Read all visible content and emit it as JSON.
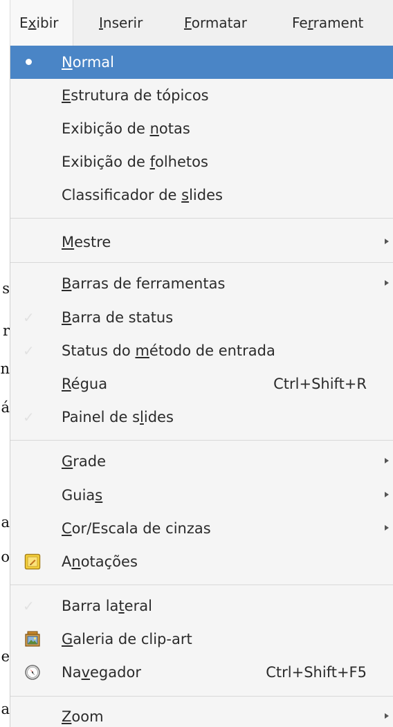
{
  "background_doc_chars": [
    "s",
    "r",
    "n",
    "á",
    "a",
    "o",
    "e",
    "a"
  ],
  "menubar": {
    "items": [
      {
        "pre": "E",
        "u": "x",
        "post": "ibir"
      },
      {
        "pre": "",
        "u": "I",
        "post": "nserir"
      },
      {
        "pre": "",
        "u": "F",
        "post": "ormatar"
      },
      {
        "pre": "Fe",
        "u": "r",
        "post": "rament"
      }
    ]
  },
  "menu": {
    "items": [
      {
        "pre": "",
        "u": "N",
        "post": "ormal",
        "state": "radio-selected",
        "highlighted": true
      },
      {
        "pre": "",
        "u": "E",
        "post": "strutura de tópicos"
      },
      {
        "pre": "Exibição de ",
        "u": "n",
        "post": "otas"
      },
      {
        "pre": "Exibição de ",
        "u": "f",
        "post": "olhetos"
      },
      {
        "pre": "Classificador de ",
        "u": "s",
        "post": "lides"
      },
      {
        "pre": "",
        "u": "M",
        "post": "estre",
        "submenu": true
      },
      {
        "pre": "",
        "u": "B",
        "post": "arras de ferramentas",
        "submenu": true
      },
      {
        "pre": "",
        "u": "B",
        "post": "arra de status",
        "check": "✓"
      },
      {
        "pre": "Status do ",
        "u": "m",
        "post": "étodo de entrada",
        "check": "✓"
      },
      {
        "pre": "",
        "u": "R",
        "post": "égua",
        "shortcut": "Ctrl+Shift+R"
      },
      {
        "pre": "Painel de s",
        "u": "l",
        "post": "ides",
        "check": "✓"
      },
      {
        "pre": "",
        "u": "G",
        "post": "rade",
        "submenu": true
      },
      {
        "pre": "Guia",
        "u": "s",
        "post": "",
        "submenu": true
      },
      {
        "pre": "",
        "u": "C",
        "post": "or/Escala de cinzas",
        "submenu": true
      },
      {
        "pre": "A",
        "u": "n",
        "post": "otações",
        "icon": "annotations-icon"
      },
      {
        "pre": "Barra la",
        "u": "t",
        "post": "eral",
        "check": "✓"
      },
      {
        "pre": "",
        "u": "G",
        "post": "aleria de clip-art",
        "icon": "gallery-icon"
      },
      {
        "pre": "Na",
        "u": "v",
        "post": "egador",
        "shortcut": "Ctrl+Shift+F5",
        "icon": "navigator-icon"
      },
      {
        "pre": "",
        "u": "Z",
        "post": "oom",
        "submenu": true
      }
    ]
  },
  "colors": {
    "highlight": "#4a85c6",
    "menu_background": "#f5f5f5",
    "menubar_background": "#f0f0f0",
    "text": "#2b2b2b"
  }
}
